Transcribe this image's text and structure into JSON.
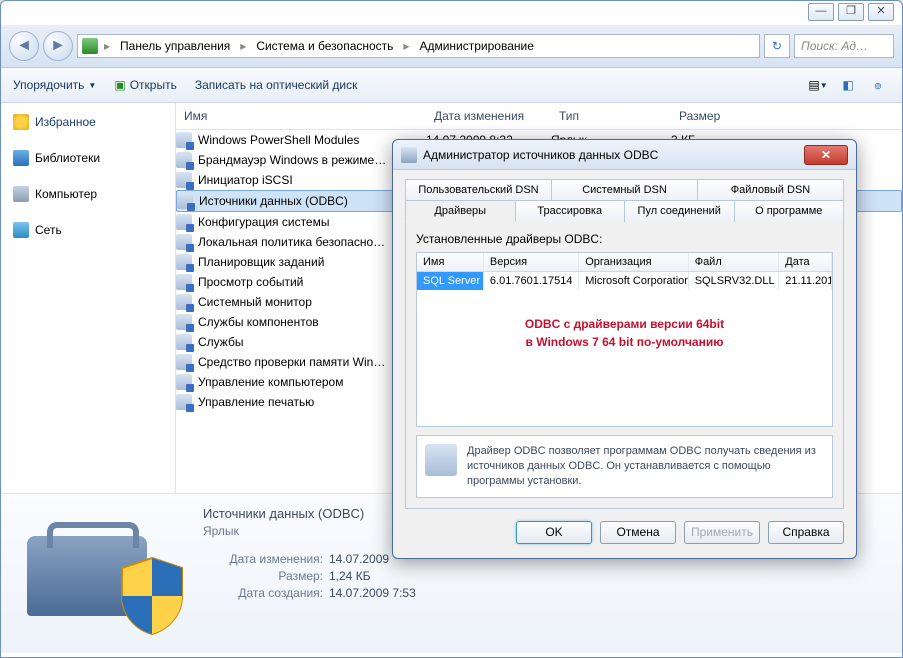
{
  "title_controls": {
    "min": "—",
    "max": "❐",
    "close": "✕"
  },
  "breadcrumb": {
    "items": [
      "Панель управления",
      "Система и безопасность",
      "Администрирование"
    ]
  },
  "search": {
    "placeholder": "Поиск: Ад…"
  },
  "toolbar": {
    "organize": "Упорядочить",
    "open": "Открыть",
    "burn": "Записать на оптический диск"
  },
  "nav": {
    "favorites": "Избранное",
    "libraries": "Библиотеки",
    "computer": "Компьютер",
    "network": "Сеть"
  },
  "columns": {
    "name": "Имя",
    "date": "Дата изменения",
    "type": "Тип",
    "size": "Размер"
  },
  "files": [
    {
      "name": "Windows PowerShell Modules",
      "date": "14.07.2009 8:32",
      "type": "Ярлык",
      "size": "3 КБ"
    },
    {
      "name": "Брандмауэр Windows в режиме…",
      "date": "",
      "type": "",
      "size": ""
    },
    {
      "name": "Инициатор iSCSI",
      "date": "",
      "type": "",
      "size": ""
    },
    {
      "name": "Источники данных (ODBC)",
      "date": "",
      "type": "",
      "size": "",
      "selected": true
    },
    {
      "name": "Конфигурация системы",
      "date": "",
      "type": "",
      "size": ""
    },
    {
      "name": "Локальная политика безопасно…",
      "date": "",
      "type": "",
      "size": ""
    },
    {
      "name": "Планировщик заданий",
      "date": "",
      "type": "",
      "size": ""
    },
    {
      "name": "Просмотр событий",
      "date": "",
      "type": "",
      "size": ""
    },
    {
      "name": "Системный монитор",
      "date": "",
      "type": "",
      "size": ""
    },
    {
      "name": "Службы компонентов",
      "date": "",
      "type": "",
      "size": ""
    },
    {
      "name": "Службы",
      "date": "",
      "type": "",
      "size": ""
    },
    {
      "name": "Средство проверки памяти Win…",
      "date": "",
      "type": "",
      "size": ""
    },
    {
      "name": "Управление компьютером",
      "date": "",
      "type": "",
      "size": ""
    },
    {
      "name": "Управление печатью",
      "date": "",
      "type": "",
      "size": ""
    }
  ],
  "details": {
    "title": "Источники данных (ODBC)",
    "type": "Ярлык",
    "rows": [
      {
        "lbl": "Дата изменения:",
        "val": "14.07.2009"
      },
      {
        "lbl": "Размер:",
        "val": "1,24 КБ"
      },
      {
        "lbl": "Дата создания:",
        "val": "14.07.2009 7:53"
      }
    ]
  },
  "dialog": {
    "title": "Администратор источников данных ODBC",
    "tabs_row1": [
      "Пользовательский DSN",
      "Системный DSN",
      "Файловый DSN"
    ],
    "tabs_row2": [
      "Драйверы",
      "Трассировка",
      "Пул соединений",
      "О программе"
    ],
    "drivers_label": "Установленные драйверы ODBC:",
    "drv_cols": {
      "name": "Имя",
      "ver": "Версия",
      "org": "Организация",
      "file": "Файл",
      "date": "Дата"
    },
    "drv_rows": [
      {
        "name": "SQL Server",
        "ver": "6.01.7601.17514",
        "org": "Microsoft Corporation",
        "file": "SQLSRV32.DLL",
        "date": "21.11.201"
      }
    ],
    "annotation_l1": "ODBC с драйверами версии 64bit",
    "annotation_l2": "в Windows 7 64 bit по-умолчанию",
    "info": "Драйвер ODBC позволяет программам ODBC получать сведения из источников данных ODBC.  Он устанавливается с помощью программы установки.",
    "buttons": {
      "ok": "OK",
      "cancel": "Отмена",
      "apply": "Применить",
      "help": "Справка"
    }
  }
}
